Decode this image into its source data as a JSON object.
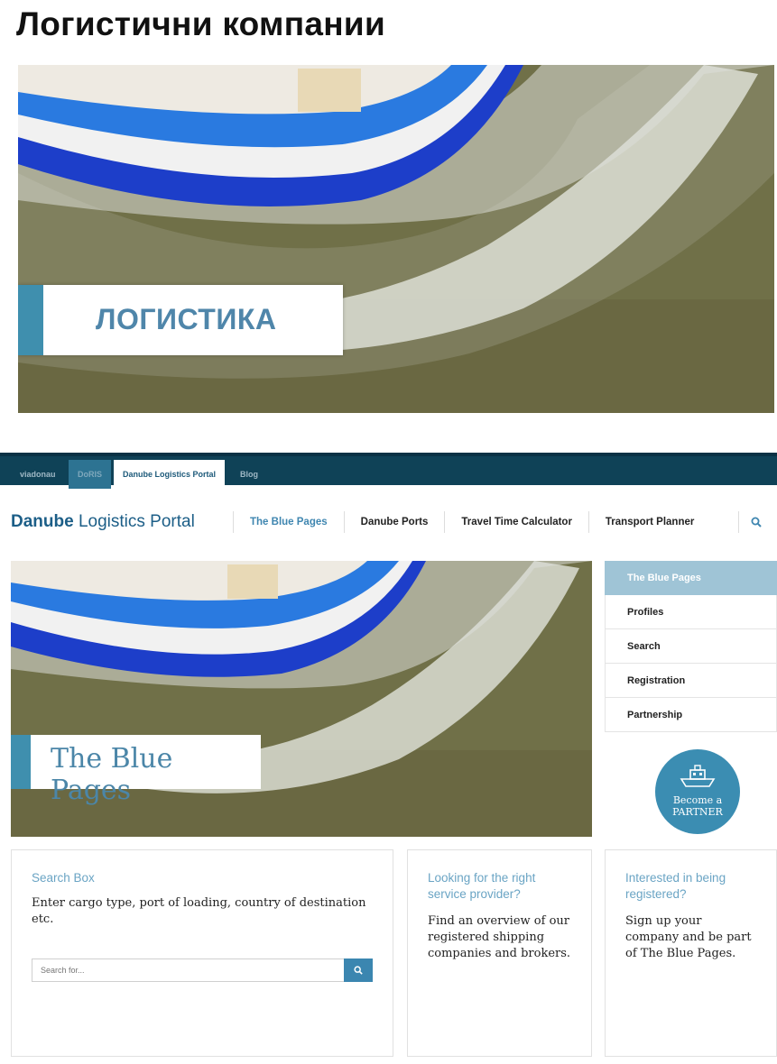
{
  "slide": {
    "title": "Логистични компании",
    "hero_caption": "ЛОГИСТИКА"
  },
  "topbar": {
    "tabs": [
      "viadonau",
      "DoRIS",
      "Danube Logistics Portal",
      "Blog"
    ],
    "active_tab": "Danube Logistics Portal"
  },
  "header": {
    "brand_bold": "Danube",
    "brand_rest": " Logistics Portal",
    "nav": [
      "The Blue Pages",
      "Danube Ports",
      "Travel Time Calculator",
      "Transport Planner"
    ],
    "search_icon": "search-icon"
  },
  "hero": {
    "caption": "The Blue Pages"
  },
  "sidebar": {
    "items": [
      "The Blue Pages",
      "Profiles",
      "Search",
      "Registration",
      "Partnership"
    ],
    "partner_line1": "Become a",
    "partner_line2": "PARTNER"
  },
  "cards": {
    "search_box": {
      "title": "Search Box",
      "text": "Enter cargo type, port of loading, country of destination etc.",
      "placeholder": "Search for..."
    },
    "provider": {
      "title": "Looking for the right service provider?",
      "text": "Find an overview of our registered shipping companies and brokers."
    },
    "register": {
      "title": "Interested in being registered?",
      "text": "Sign up your company and be part of The Blue Pages."
    }
  },
  "colors": {
    "accent": "#3f8fae",
    "topbar": "#0f4257",
    "link_blue": "#3f86b0"
  }
}
